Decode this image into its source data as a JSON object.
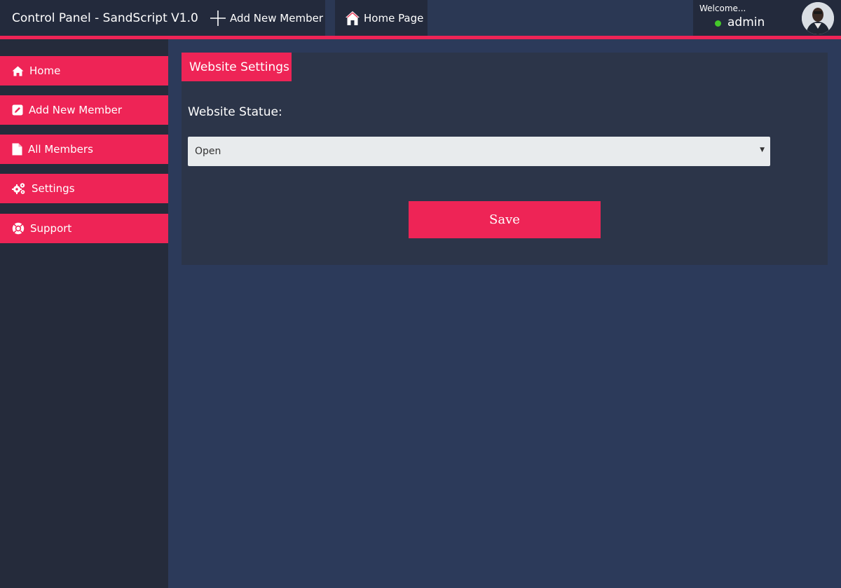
{
  "app": {
    "title": "Control Panel - SandScript V1.0"
  },
  "topnav": {
    "add_member_label": "Add New Member",
    "home_page_label": "Home Page"
  },
  "user": {
    "welcome": "Welcome...",
    "name": "admin",
    "status_color": "#44c82a"
  },
  "sidebar": {
    "items": [
      {
        "label": "Home",
        "icon": "home-icon"
      },
      {
        "label": "Add New Member",
        "icon": "edit-icon"
      },
      {
        "label": "All Members",
        "icon": "file-icon"
      },
      {
        "label": "Settings",
        "icon": "gears-icon"
      },
      {
        "label": "Support",
        "icon": "lifebuoy-icon"
      }
    ]
  },
  "settings": {
    "title": "Website Settings",
    "status_label": "Website Statue:",
    "status_value": "Open",
    "save_label": "Save"
  },
  "colors": {
    "accent": "#ee2456",
    "sidebar_bg": "#252b3b",
    "page_bg": "#2c3a5a",
    "panel_bg": "#2c3549"
  }
}
